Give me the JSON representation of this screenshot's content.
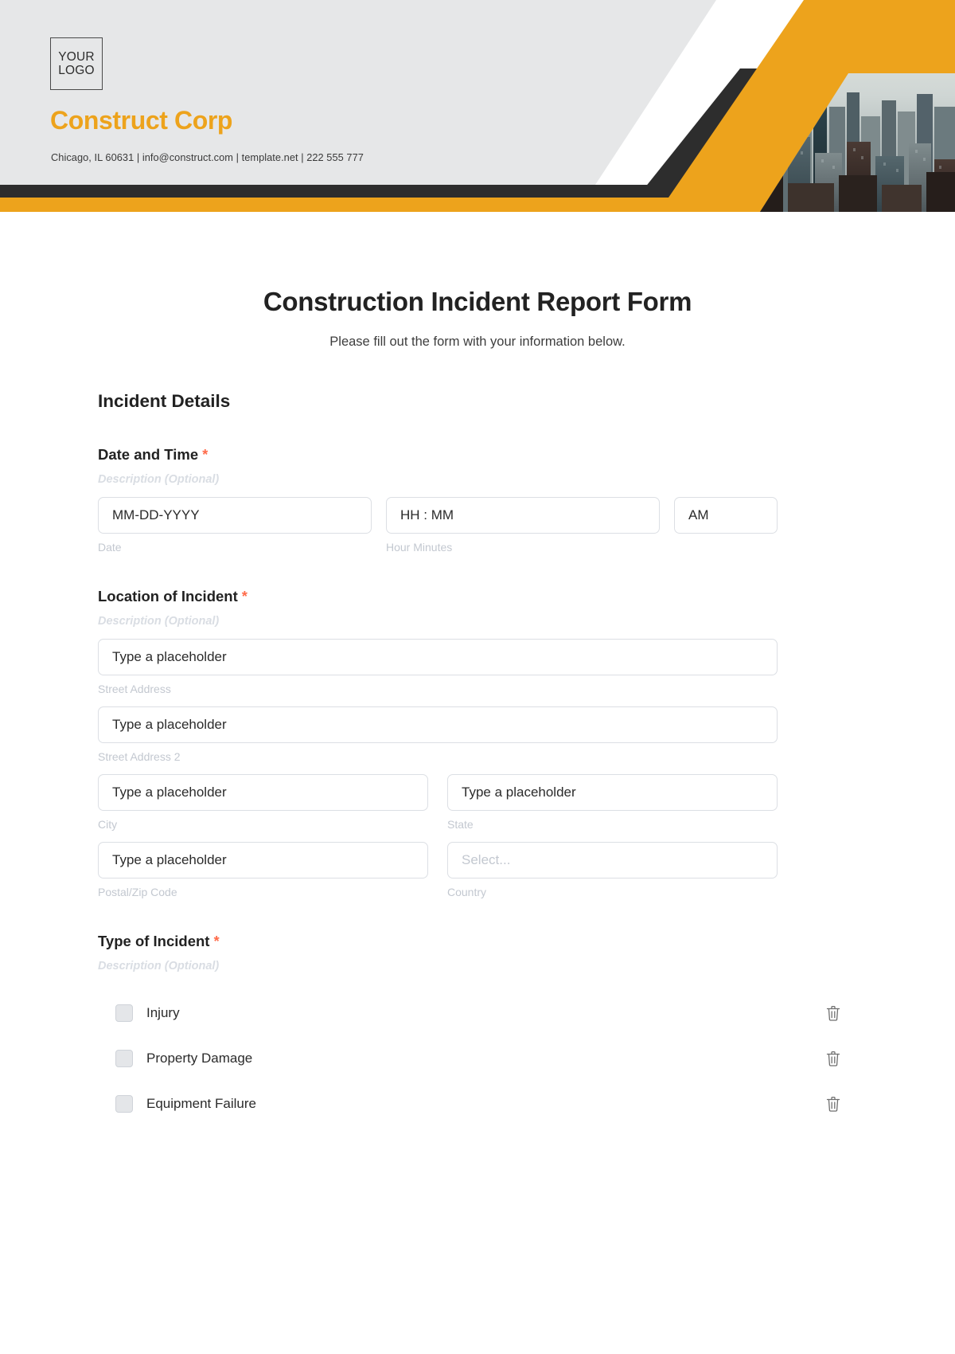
{
  "header": {
    "logo_line1": "YOUR",
    "logo_line2": "LOGO",
    "company_name": "Construct Corp",
    "contact_line": "Chicago, IL 60631 | info@construct.com | template.net | 222 555 777",
    "accent_color": "#eda31c",
    "dark_color": "#2d2d2d",
    "panel_color": "#e6e7e8",
    "photo_alt": "city-skyline-photo"
  },
  "form": {
    "title": "Construction Incident Report Form",
    "subtitle": "Please fill out the form with your information below.",
    "section_heading": "Incident Details",
    "required_marker": "*",
    "description_placeholder": "Description (Optional)",
    "fields": {
      "date_time": {
        "label": "Date and Time",
        "description": "Description (Optional)",
        "date_value": "MM-DD-YYYY",
        "date_sublabel": "Date",
        "time_value": "HH : MM",
        "time_sublabel": "Hour Minutes",
        "meridiem_value": "AM"
      },
      "location": {
        "label": "Location of Incident",
        "description": "Description (Optional)",
        "street_address_value": "Type a placeholder",
        "street_address_sublabel": "Street Address",
        "street_address2_value": "Type a placeholder",
        "street_address2_sublabel": "Street Address 2",
        "city_value": "Type a placeholder",
        "city_sublabel": "City",
        "state_value": "Type a placeholder",
        "state_sublabel": "State",
        "postal_value": "Type a placeholder",
        "postal_sublabel": "Postal/Zip Code",
        "country_value": "Select...",
        "country_sublabel": "Country"
      },
      "incident_type": {
        "label": "Type of Incident",
        "description": "Description (Optional)",
        "options": [
          {
            "label": "Injury"
          },
          {
            "label": "Property Damage"
          },
          {
            "label": "Equipment Failure"
          }
        ]
      }
    }
  }
}
